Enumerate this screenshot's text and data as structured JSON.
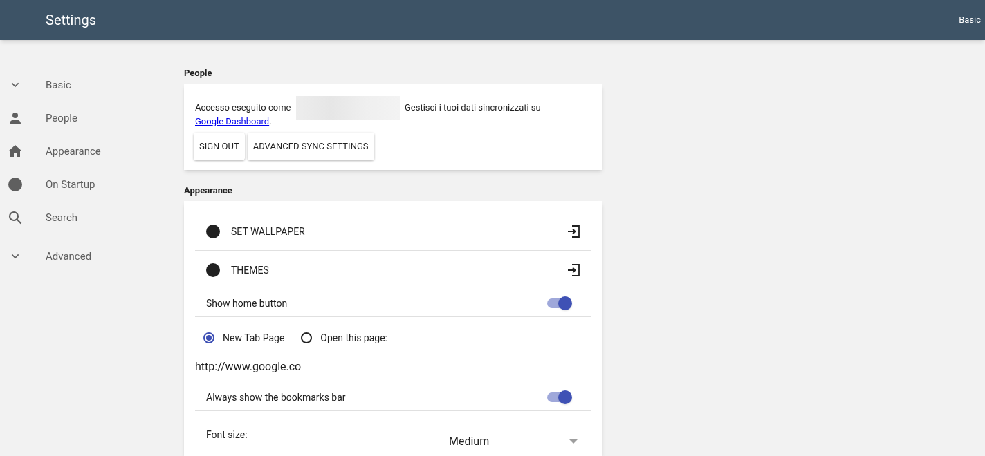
{
  "header": {
    "title": "Settings",
    "right_label": "Basic"
  },
  "sidebar": {
    "items": [
      {
        "kind": "section",
        "label": "Basic",
        "expanded": true
      },
      {
        "kind": "person",
        "label": "People"
      },
      {
        "kind": "home",
        "label": "Appearance"
      },
      {
        "kind": "circle",
        "label": "On Startup"
      },
      {
        "kind": "search",
        "label": "Search"
      },
      {
        "kind": "section",
        "label": "Advanced",
        "expanded": true
      }
    ]
  },
  "people": {
    "heading": "People",
    "signed_in_text": "Accesso eseguito come",
    "manage_text": "Gestisci i tuoi dati sincronizzati su",
    "link": "Google Dashboard",
    "after_link": ".",
    "buttons": [
      "SIGN OUT",
      "ADVANCED SYNC SETTINGS"
    ]
  },
  "appearance": {
    "heading": "Appearance",
    "rows": [
      {
        "kind": "launch",
        "label": "SET WALLPAPER"
      },
      {
        "kind": "launch",
        "label": "THEMES"
      },
      {
        "kind": "toggle",
        "label": "Show home button",
        "on": true
      },
      {
        "kind": "radios",
        "options": [
          {
            "label": "New Tab Page",
            "selected": true
          },
          {
            "label": "Open this page:",
            "selected": false
          }
        ]
      },
      {
        "kind": "input",
        "value": "http://www.google.co"
      },
      {
        "kind": "toggle",
        "label": "Always show the bookmarks bar",
        "on": true
      },
      {
        "kind": "select",
        "label": "Font size:",
        "value": "Medium"
      }
    ]
  }
}
